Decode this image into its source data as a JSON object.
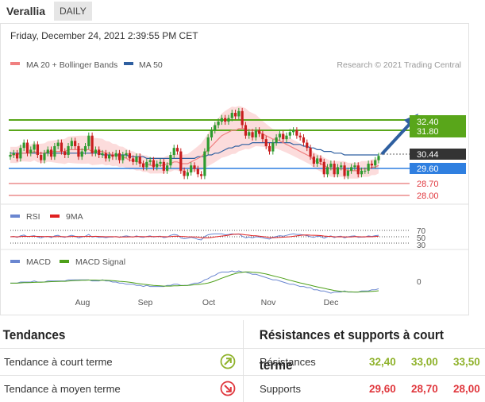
{
  "header": {
    "title": "Verallia",
    "tab": "DAILY"
  },
  "chart": {
    "timestamp": "Friday, December 24, 2021 2:39:55 PM CET",
    "copyright": "Research © 2021 Trading Central",
    "legend_ma20": "MA 20 + Bollinger Bands",
    "legend_ma50": "MA 50",
    "legend_rsi": "RSI",
    "legend_9ma": "9MA",
    "legend_macd": "MACD",
    "legend_macd_signal": "MACD Signal",
    "rsi_level_70": "70",
    "rsi_level_50": "50",
    "rsi_level_30": "30",
    "macd_zero": "0",
    "colors": {
      "ma20": "#f08080",
      "ma50": "#2e5fa0",
      "bands": "#fbd0d0",
      "up": "#2e9b2e",
      "down": "#c81e1e",
      "resistance": "#59a61a",
      "support": "#2f7fe0",
      "level": "#e05050"
    }
  },
  "chart_data": {
    "type": "candlestick",
    "x_tick_labels": [
      "Aug",
      "Sep",
      "Oct",
      "Nov",
      "Dec"
    ],
    "price_labels": {
      "resistance_1": "32.40",
      "resistance_2": "31.80",
      "current": "30.44",
      "support_1": "29.60",
      "support_2": "28.70",
      "support_3": "28.00"
    },
    "levels": {
      "resistance_1": 32.4,
      "resistance_2": 31.8,
      "current": 30.44,
      "support_1": 29.6,
      "support_2": 28.7,
      "support_3": 28.0
    },
    "ylim": [
      27.6,
      33.4
    ],
    "close": [
      30.5,
      30.6,
      30.3,
      30.9,
      31.2,
      30.6,
      30.8,
      31.1,
      30.5,
      30.2,
      30.6,
      30.8,
      30.4,
      31.0,
      31.2,
      30.7,
      30.5,
      31.0,
      31.3,
      31.0,
      30.4,
      30.7,
      31.0,
      31.6,
      30.6,
      30.8,
      30.5,
      30.6,
      30.3,
      30.5,
      30.4,
      30.6,
      30.2,
      30.5,
      30.6,
      30.3,
      30.1,
      30.4,
      30.0,
      29.8,
      30.1,
      30.2,
      29.8,
      30.0,
      30.1,
      29.6,
      29.9,
      30.5,
      30.9,
      30.7,
      29.6,
      29.3,
      29.5,
      29.9,
      29.7,
      29.4,
      29.3,
      30.7,
      31.5,
      31.9,
      32.2,
      32.4,
      32.6,
      32.4,
      32.6,
      32.9,
      32.7,
      33.0,
      32.2,
      31.6,
      31.8,
      31.5,
      31.9,
      31.7,
      31.4,
      31.0,
      30.7,
      31.2,
      31.5,
      31.7,
      31.4,
      31.6,
      31.8,
      31.9,
      31.6,
      31.5,
      31.2,
      30.9,
      30.4,
      30.0,
      30.3,
      30.1,
      29.4,
      29.8,
      30.0,
      29.4,
      29.8,
      29.9,
      29.3,
      29.6,
      29.8,
      29.9,
      29.4,
      29.6,
      29.6,
      30.0,
      29.9,
      30.2,
      30.44
    ],
    "ma20": [
      30.5,
      30.5,
      30.5,
      30.6,
      30.6,
      30.6,
      30.6,
      30.7,
      30.6,
      30.6,
      30.6,
      30.7,
      30.7,
      30.7,
      30.7,
      30.7,
      30.7,
      30.8,
      30.8,
      30.8,
      30.8,
      30.8,
      30.8,
      30.8,
      30.7,
      30.7,
      30.7,
      30.7,
      30.6,
      30.6,
      30.5,
      30.5,
      30.4,
      30.4,
      30.3,
      30.2,
      30.2,
      30.1,
      30.1,
      30.0,
      30.0,
      29.9,
      29.9,
      29.9,
      29.9,
      29.9,
      30.0,
      30.0,
      30.1,
      30.1,
      30.0,
      30.0,
      30.0,
      30.1,
      30.2,
      30.3,
      30.4,
      30.6,
      30.8,
      31.0,
      31.2,
      31.4,
      31.6,
      31.7,
      31.8,
      31.9,
      31.9,
      32.0,
      32.0,
      32.0,
      31.9,
      31.9,
      31.9,
      31.8,
      31.7,
      31.6,
      31.5,
      31.4,
      31.4,
      31.3,
      31.2,
      31.1,
      31.0,
      30.9,
      30.8,
      30.7,
      30.6,
      30.5,
      30.4,
      30.2,
      30.1,
      30.0,
      29.9,
      29.8,
      29.7,
      29.7,
      29.7,
      29.7,
      29.7,
      29.6,
      29.6,
      29.6,
      29.6,
      29.7,
      29.7,
      29.7,
      29.8,
      29.8,
      29.9
    ],
    "ma50": [
      30.6,
      30.6,
      30.6,
      30.6,
      30.6,
      30.6,
      30.6,
      30.6,
      30.6,
      30.6,
      30.6,
      30.6,
      30.6,
      30.6,
      30.6,
      30.6,
      30.6,
      30.6,
      30.6,
      30.6,
      30.6,
      30.6,
      30.6,
      30.6,
      30.6,
      30.6,
      30.6,
      30.5,
      30.5,
      30.5,
      30.5,
      30.5,
      30.5,
      30.5,
      30.5,
      30.4,
      30.4,
      30.4,
      30.4,
      30.4,
      30.3,
      30.3,
      30.3,
      30.3,
      30.3,
      30.3,
      30.3,
      30.3,
      30.3,
      30.3,
      30.3,
      30.3,
      30.3,
      30.3,
      30.3,
      30.4,
      30.4,
      30.4,
      30.5,
      30.5,
      30.6,
      30.6,
      30.7,
      30.8,
      30.9,
      30.9,
      31.0,
      31.0,
      31.1,
      31.1,
      31.1,
      31.2,
      31.2,
      31.2,
      31.2,
      31.2,
      31.2,
      31.2,
      31.2,
      31.2,
      31.2,
      31.2,
      31.2,
      31.1,
      31.1,
      31.1,
      31.0,
      31.0,
      30.9,
      30.9,
      30.8,
      30.8,
      30.7,
      30.7,
      30.7,
      30.6,
      30.6,
      30.6,
      30.5,
      30.5,
      30.5,
      30.5,
      30.5,
      30.5,
      30.5,
      30.5,
      30.5,
      30.5,
      30.5
    ],
    "rsi_ylim": [
      20,
      80
    ],
    "macd_ylim": [
      -1,
      1
    ]
  },
  "trends": {
    "title": "Tendances",
    "short_label": "Tendance à court terme",
    "medium_label": "Tendance à moyen terme"
  },
  "levels_table": {
    "title": "Résistances et supports à court terme",
    "resistances_label": "Résistances",
    "supports_label": "Supports",
    "resistances": [
      "32,40",
      "33,00",
      "33,50"
    ],
    "supports": [
      "29,60",
      "28,70",
      "28,00"
    ]
  }
}
